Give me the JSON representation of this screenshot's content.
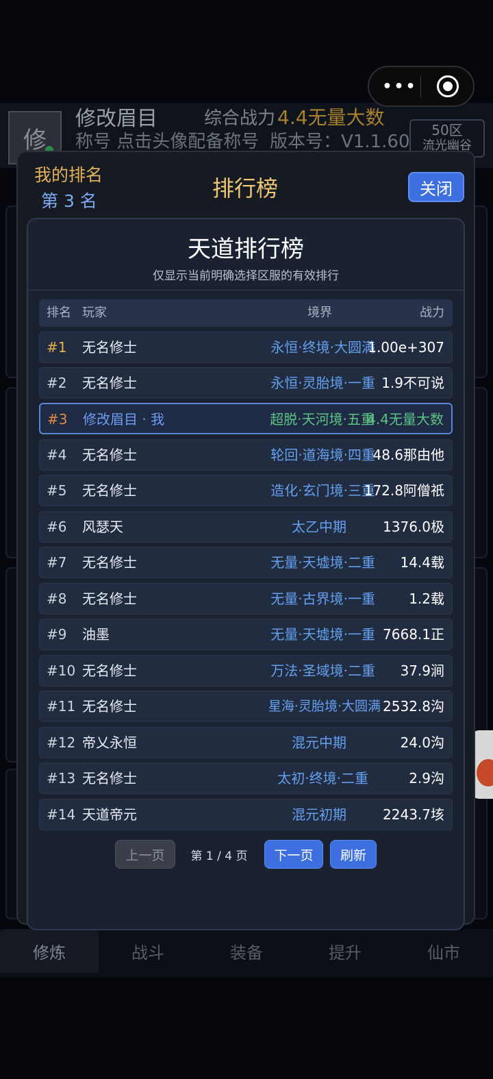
{
  "header": {
    "avatar_char": "修",
    "name": "修改眉目",
    "power_label": "综合战力",
    "power_value": "4.4无量大数",
    "title_row": "称号 点击头像配备称号",
    "version": "版本号：V1.1.60",
    "server_line1": "50区",
    "server_line2": "流光幽谷"
  },
  "capsule": {
    "more_icon": "more-dots-icon",
    "target_icon": "target-icon"
  },
  "bottom_tabs": [
    "修炼",
    "战斗",
    "装备",
    "提升",
    "仙市"
  ],
  "modal": {
    "my_rank_label": "我的排名",
    "my_rank_value": "第 3 名",
    "title": "排行榜",
    "close_label": "关闭",
    "board_title": "天道排行榜",
    "board_subtitle": "仅显示当前明确选择区服的有效排行",
    "columns": {
      "rank": "排名",
      "player": "玩家",
      "realm": "境界",
      "power": "战力"
    },
    "rows": [
      {
        "rank": "#1",
        "player": "无名修士",
        "realm": "永恒·终境·大圆满",
        "power": "1.00e+307"
      },
      {
        "rank": "#2",
        "player": "无名修士",
        "realm": "永恒·灵胎境·一重",
        "power": "1.9不可说"
      },
      {
        "rank": "#3",
        "player": "修改眉目 · 我",
        "realm": "超脱·天河境·五重",
        "power": "4.4无量大数"
      },
      {
        "rank": "#4",
        "player": "无名修士",
        "realm": "轮回·道海境·四重",
        "power": "48.6那由他"
      },
      {
        "rank": "#5",
        "player": "无名修士",
        "realm": "造化·玄门境·三重",
        "power": "172.8阿僧祇"
      },
      {
        "rank": "#6",
        "player": "风瑟天",
        "realm": "太乙中期",
        "power": "1376.0极"
      },
      {
        "rank": "#7",
        "player": "无名修士",
        "realm": "无量·天墟境·二重",
        "power": "14.4载"
      },
      {
        "rank": "#8",
        "player": "无名修士",
        "realm": "无量·古界境·一重",
        "power": "1.2载"
      },
      {
        "rank": "#9",
        "player": "油墨",
        "realm": "无量·天墟境·一重",
        "power": "7668.1正"
      },
      {
        "rank": "#10",
        "player": "无名修士",
        "realm": "万法·圣域境·二重",
        "power": "37.9涧"
      },
      {
        "rank": "#11",
        "player": "无名修士",
        "realm": "星海·灵胎境·大圆满",
        "power": "2532.8沟"
      },
      {
        "rank": "#12",
        "player": "帝乂永恒",
        "realm": "混元中期",
        "power": "24.0沟"
      },
      {
        "rank": "#13",
        "player": "无名修士",
        "realm": "太初·终境·二重",
        "power": "2.9沟"
      },
      {
        "rank": "#14",
        "player": "天道帝元",
        "realm": "混元初期",
        "power": "2243.7垓"
      }
    ],
    "pager": {
      "prev_label": "上一页",
      "page_info": "第 1 / 4 页",
      "next_label": "下一页",
      "refresh_label": "刷新"
    }
  },
  "colors": {
    "accent_blue": "#3d6fe0",
    "gold": "#e7b24a",
    "me_green": "#5cc486",
    "realm_blue": "#63a0ee"
  }
}
